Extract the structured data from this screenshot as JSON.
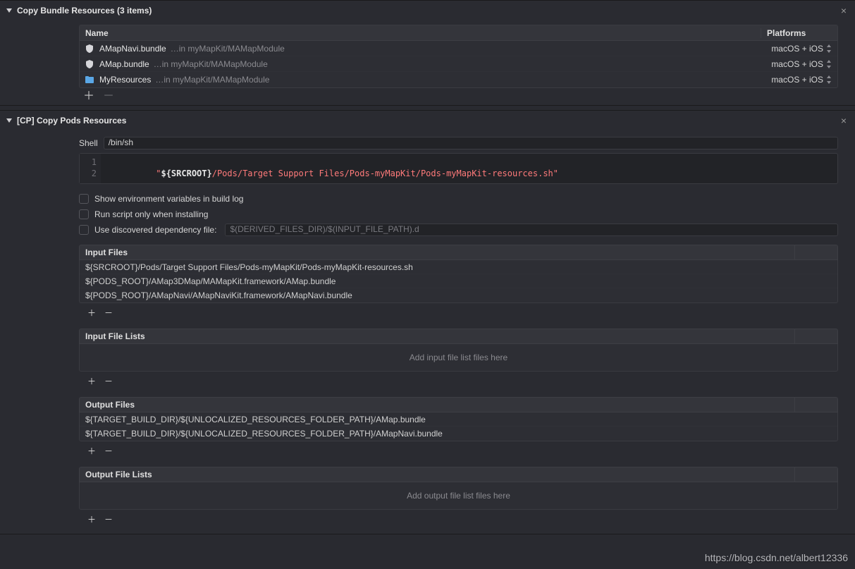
{
  "copyBundle": {
    "title": "Copy Bundle Resources",
    "count": "(3 items)",
    "columns": {
      "name": "Name",
      "platforms": "Platforms"
    },
    "rows": [
      {
        "icon": "shield",
        "name": "AMapNavi.bundle",
        "sub": "…in myMapKit/MAMapModule",
        "platforms": "macOS + iOS"
      },
      {
        "icon": "shield",
        "name": "AMap.bundle",
        "sub": "…in myMapKit/MAMapModule",
        "platforms": "macOS + iOS"
      },
      {
        "icon": "folder",
        "name": "MyResources",
        "sub": "…in myMapKit/MAMapModule",
        "platforms": "macOS + iOS"
      }
    ]
  },
  "copyPods": {
    "title": "[CP] Copy Pods Resources",
    "shell_label": "Shell",
    "shell_value": "/bin/sh",
    "script": {
      "q": "\"",
      "var": "${SRCROOT}",
      "path": "/Pods/Target Support Files/Pods-myMapKit/Pods-myMapKit-resources.sh"
    },
    "checks": {
      "show_env": "Show environment variables in build log",
      "run_install": "Run script only when installing",
      "dep_file": "Use discovered dependency file:",
      "dep_placeholder": "$(DERIVED_FILES_DIR)/$(INPUT_FILE_PATH).d"
    },
    "inputFiles": {
      "title": "Input Files",
      "rows": [
        "${SRCROOT}/Pods/Target Support Files/Pods-myMapKit/Pods-myMapKit-resources.sh",
        "${PODS_ROOT}/AMap3DMap/MAMapKit.framework/AMap.bundle",
        "${PODS_ROOT}/AMapNavi/AMapNaviKit.framework/AMapNavi.bundle"
      ]
    },
    "inputFileLists": {
      "title": "Input File Lists",
      "placeholder": "Add input file list files here"
    },
    "outputFiles": {
      "title": "Output Files",
      "rows": [
        "${TARGET_BUILD_DIR}/${UNLOCALIZED_RESOURCES_FOLDER_PATH}/AMap.bundle",
        "${TARGET_BUILD_DIR}/${UNLOCALIZED_RESOURCES_FOLDER_PATH}/AMapNavi.bundle"
      ]
    },
    "outputFileLists": {
      "title": "Output File Lists",
      "placeholder": "Add output file list files here"
    }
  },
  "watermark": "https://blog.csdn.net/albert12336"
}
